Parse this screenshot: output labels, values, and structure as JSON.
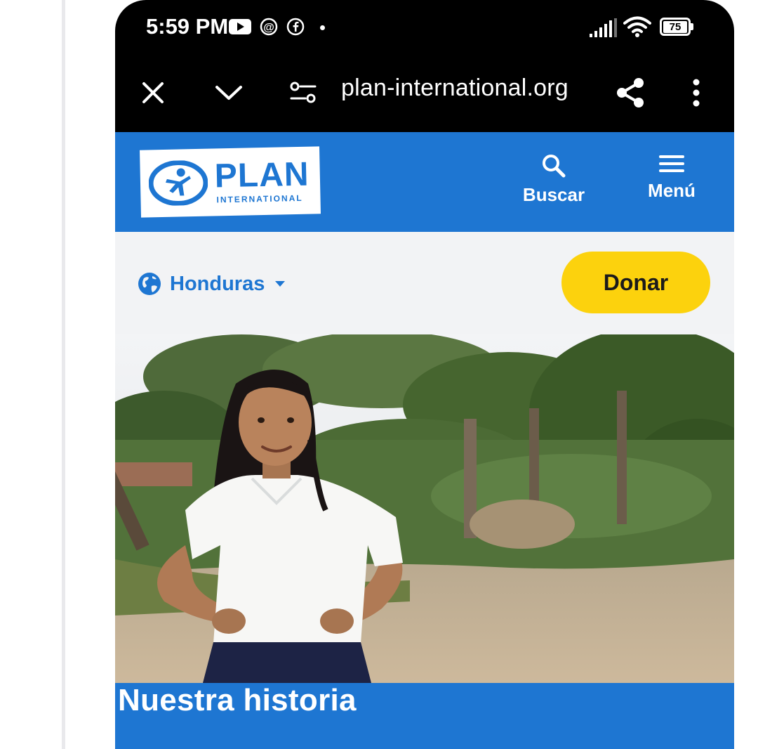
{
  "status_bar": {
    "time": "5:59 PM",
    "notification_icons": [
      "youtube-icon",
      "threads-icon",
      "facebook-icon",
      "dot-icon"
    ],
    "signal_icon": "signal-icon",
    "wifi_icon": "wifi-icon",
    "battery_level": "75"
  },
  "browser": {
    "url": "plan-international.org",
    "icons": [
      "close-icon",
      "chevron-down-icon",
      "site-settings-icon",
      "share-icon",
      "more-vert-icon"
    ]
  },
  "site_header": {
    "logo": {
      "name": "PLAN",
      "subtitle": "INTERNATIONAL"
    },
    "search_label": "Buscar",
    "menu_label": "Menú",
    "background": "#1e76d2"
  },
  "country_bar": {
    "country": "Honduras",
    "donate_label": "Donar",
    "donate_color": "#fcd20d"
  },
  "hero": {
    "title": "Nuestra historia"
  }
}
